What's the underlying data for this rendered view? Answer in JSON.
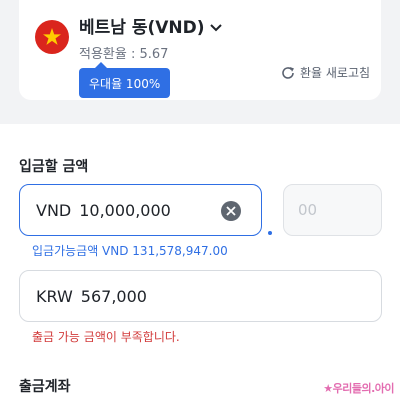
{
  "rate": {
    "currency_name": "베트남 동(VND)",
    "rate_text": "적용환율 : 5.67",
    "badge": "우대율 100%",
    "refresh_label": "환율 새로고침"
  },
  "deposit": {
    "section_label": "입금할 금액",
    "currency_code": "VND",
    "amount": "10,000,000",
    "decimal_placeholder": "00",
    "available_text": "입금가능금액 VND 131,578,947.00"
  },
  "withdraw": {
    "currency_code": "KRW",
    "amount": "567,000",
    "error_text": "출금 가능 금액이 부족합니다."
  },
  "account": {
    "section_label": "출금계좌"
  },
  "watermark": {
    "text": "★우리들의.아이"
  },
  "colors": {
    "accent": "#2f6fe4",
    "error": "#d23b3b",
    "flag_red": "#da251d",
    "flag_star": "#ffcd00"
  },
  "icons": [
    "vietnam-flag-icon",
    "chevron-down-icon",
    "refresh-icon",
    "clear-icon"
  ]
}
